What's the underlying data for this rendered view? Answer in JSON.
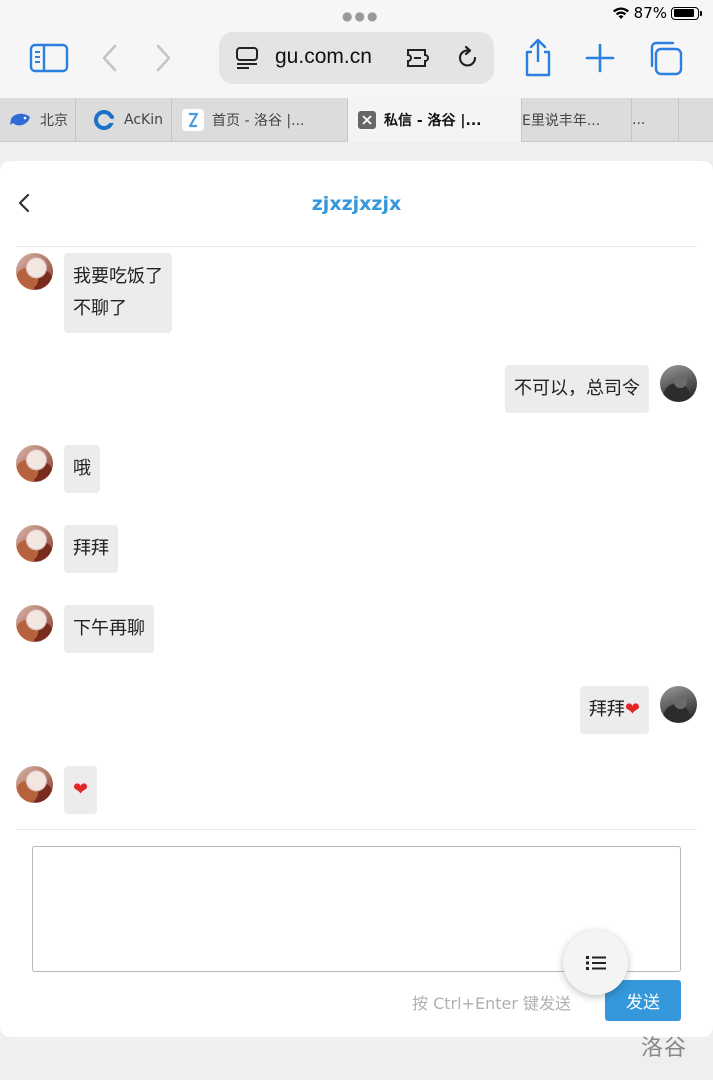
{
  "status": {
    "battery": "87%",
    "battery_level": 0.87
  },
  "browser": {
    "url_display": "gu.com.cn",
    "tabs": [
      {
        "label": "北京",
        "icon": "whale-icon",
        "color": "#3a6fd8"
      },
      {
        "label": "AcKin",
        "icon": "c-logo-icon",
        "color": "#1a73c8"
      },
      {
        "label": "首页 - 洛谷 |...",
        "icon": "luogu-icon",
        "color": "#6aa9e0"
      },
      {
        "label": "私信 - 洛谷 |...",
        "icon": "close-icon",
        "active": true
      },
      {
        "label": "E里说丰年..."
      },
      {
        "label": "..."
      }
    ]
  },
  "chat": {
    "title": "zjxzjxzjx",
    "messages": [
      {
        "side": "left",
        "lines": [
          "我要吃饭了",
          "不聊了"
        ]
      },
      {
        "side": "right",
        "lines": [
          "不可以，总司令"
        ]
      },
      {
        "side": "left",
        "lines": [
          "哦"
        ]
      },
      {
        "side": "left",
        "lines": [
          "拜拜"
        ]
      },
      {
        "side": "left",
        "lines": [
          "下午再聊"
        ]
      },
      {
        "side": "right",
        "lines": [
          "拜拜"
        ],
        "emoji": "❤"
      },
      {
        "side": "left",
        "lines": [],
        "emoji": "❤"
      }
    ]
  },
  "composer": {
    "placeholder": "",
    "hint": "按 Ctrl+Enter 键发送",
    "send_label": "发送"
  },
  "fab": {
    "icon": "list-icon"
  },
  "watermark": "洛谷"
}
